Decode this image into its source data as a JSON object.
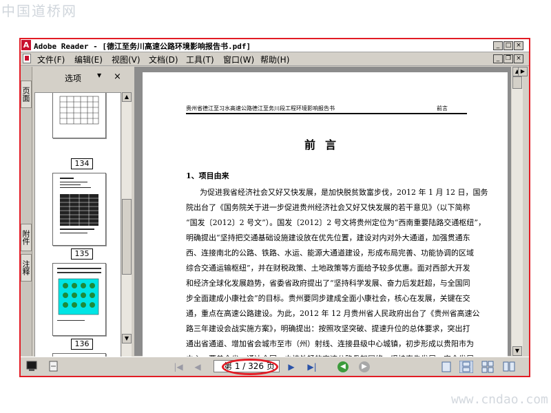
{
  "watermarks": {
    "top": "中国道桥网",
    "bottom": "www.cndao.com"
  },
  "titlebar": {
    "title": "Adobe Reader - [德江至务川高速公路环境影响报告书.pdf]",
    "buttons": [
      "_",
      "□",
      "×"
    ]
  },
  "menubar": {
    "items": [
      {
        "label": "文件(F)"
      },
      {
        "label": "编辑(E)"
      },
      {
        "label": "视图(V)"
      },
      {
        "label": "文档(D)"
      },
      {
        "label": "工具(T)"
      },
      {
        "label": "窗口(W)"
      },
      {
        "label": "帮助(H)"
      }
    ],
    "doc_buttons": [
      "_",
      "❐",
      "×"
    ]
  },
  "left_panel": {
    "tabs": [
      "页面",
      "附件",
      "注释"
    ],
    "options_label": "选项",
    "close": "×",
    "thumbnails": [
      {
        "label": "134"
      },
      {
        "label": "135"
      },
      {
        "label": "136"
      }
    ]
  },
  "document": {
    "header_left": "贵州省德江至习水高速公路德江至务川段工程环境影响报告书",
    "header_right": "前言",
    "title": "前言",
    "section_heading": "1、项目由来",
    "lines": [
      "为促进我省经济社会又好又快发展，是加快脱贫致富步伐，2012 年 1 月 12 日，国务",
      "院出台了《国务院关于进一步促进贵州经济社会又好又快发展的若干意见》（以下简称",
      "“国发〔2012〕2 号文”）。国发〔2012〕2 号文将贵州定位为“西南重要陆路交通枢纽”，",
      "明确提出“坚持把交通基础设施建设放在优先位置，建设对内对外大通道，加强贯通东",
      "西、连接南北的公路、铁路、水运、能源大通道建设，形成布局完善、功能协调的区域",
      "综合交通运输枢纽”，并在财税政策、土地政策等方面给予较多优惠。面对西部大开发",
      "和经济全球化发展趋势，省委省政府提出了“坚持科学发展、奋力后发赶超，与全国同",
      "步全面建成小康社会”的目标。贵州要同步建成全面小康社会，核心在发展，关键在交",
      "通，重点在高速公路建设。为此，2012 年 12 月贵州省人民政府出台了《贵州省高速公",
      "路三年建设会战实施方案》，明确提出：按照攻坚突破、提速升位的总体要求，突出打",
      "通出省通道、增加省会城市至市（州）射线、连接县级中心城镇，初步形成以贵阳市为",
      "中心，覆盖全省、通达全国、内捷外畅的高速公路骨架网络，坚持率先发展、安全发展"
    ]
  },
  "statusbar": {
    "page_indicator": "第 1 / 326 页",
    "first": "|◀",
    "prev": "◀",
    "next": "▶",
    "last": "▶|",
    "back": "◀",
    "forward": "▶"
  },
  "colors": {
    "highlight_red": "#e21b24",
    "back_green": "#3c9b3c",
    "forward_gray": "#a8a8a8",
    "thumb_cyan": "#00e5e5"
  }
}
